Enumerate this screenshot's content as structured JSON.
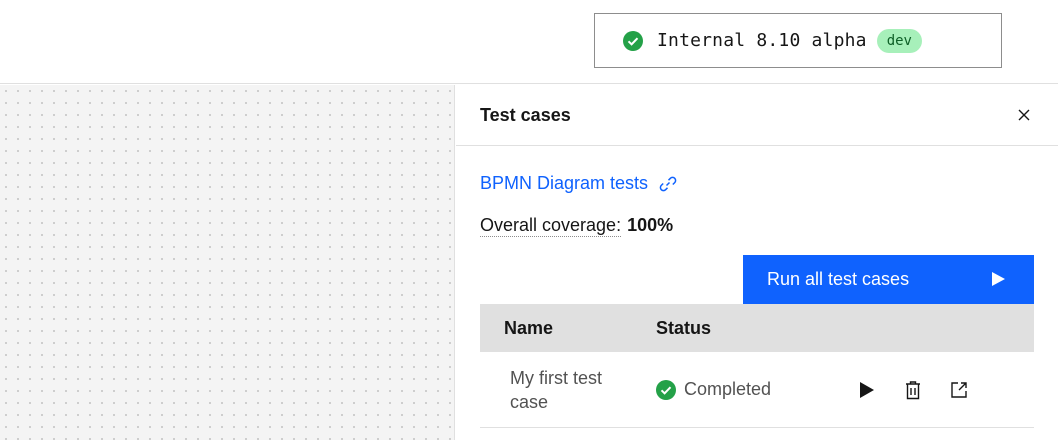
{
  "header": {
    "version": "Internal 8.10 alpha",
    "env_tag": "dev"
  },
  "panel": {
    "title": "Test cases",
    "suite_link": "BPMN Diagram tests",
    "coverage_label": "Overall coverage:",
    "coverage_value": "100%",
    "run_all_label": "Run all test cases",
    "table": {
      "columns": [
        "Name",
        "Status"
      ],
      "rows": [
        {
          "name": "My first test case",
          "status": "Completed"
        }
      ]
    }
  },
  "colors": {
    "accent": "#0f62fe",
    "success": "#24a148",
    "tag_bg": "#a7f0ba"
  },
  "icons": [
    "check-circle-icon",
    "close-icon",
    "link-icon",
    "play-icon",
    "trash-icon",
    "launch-icon"
  ]
}
